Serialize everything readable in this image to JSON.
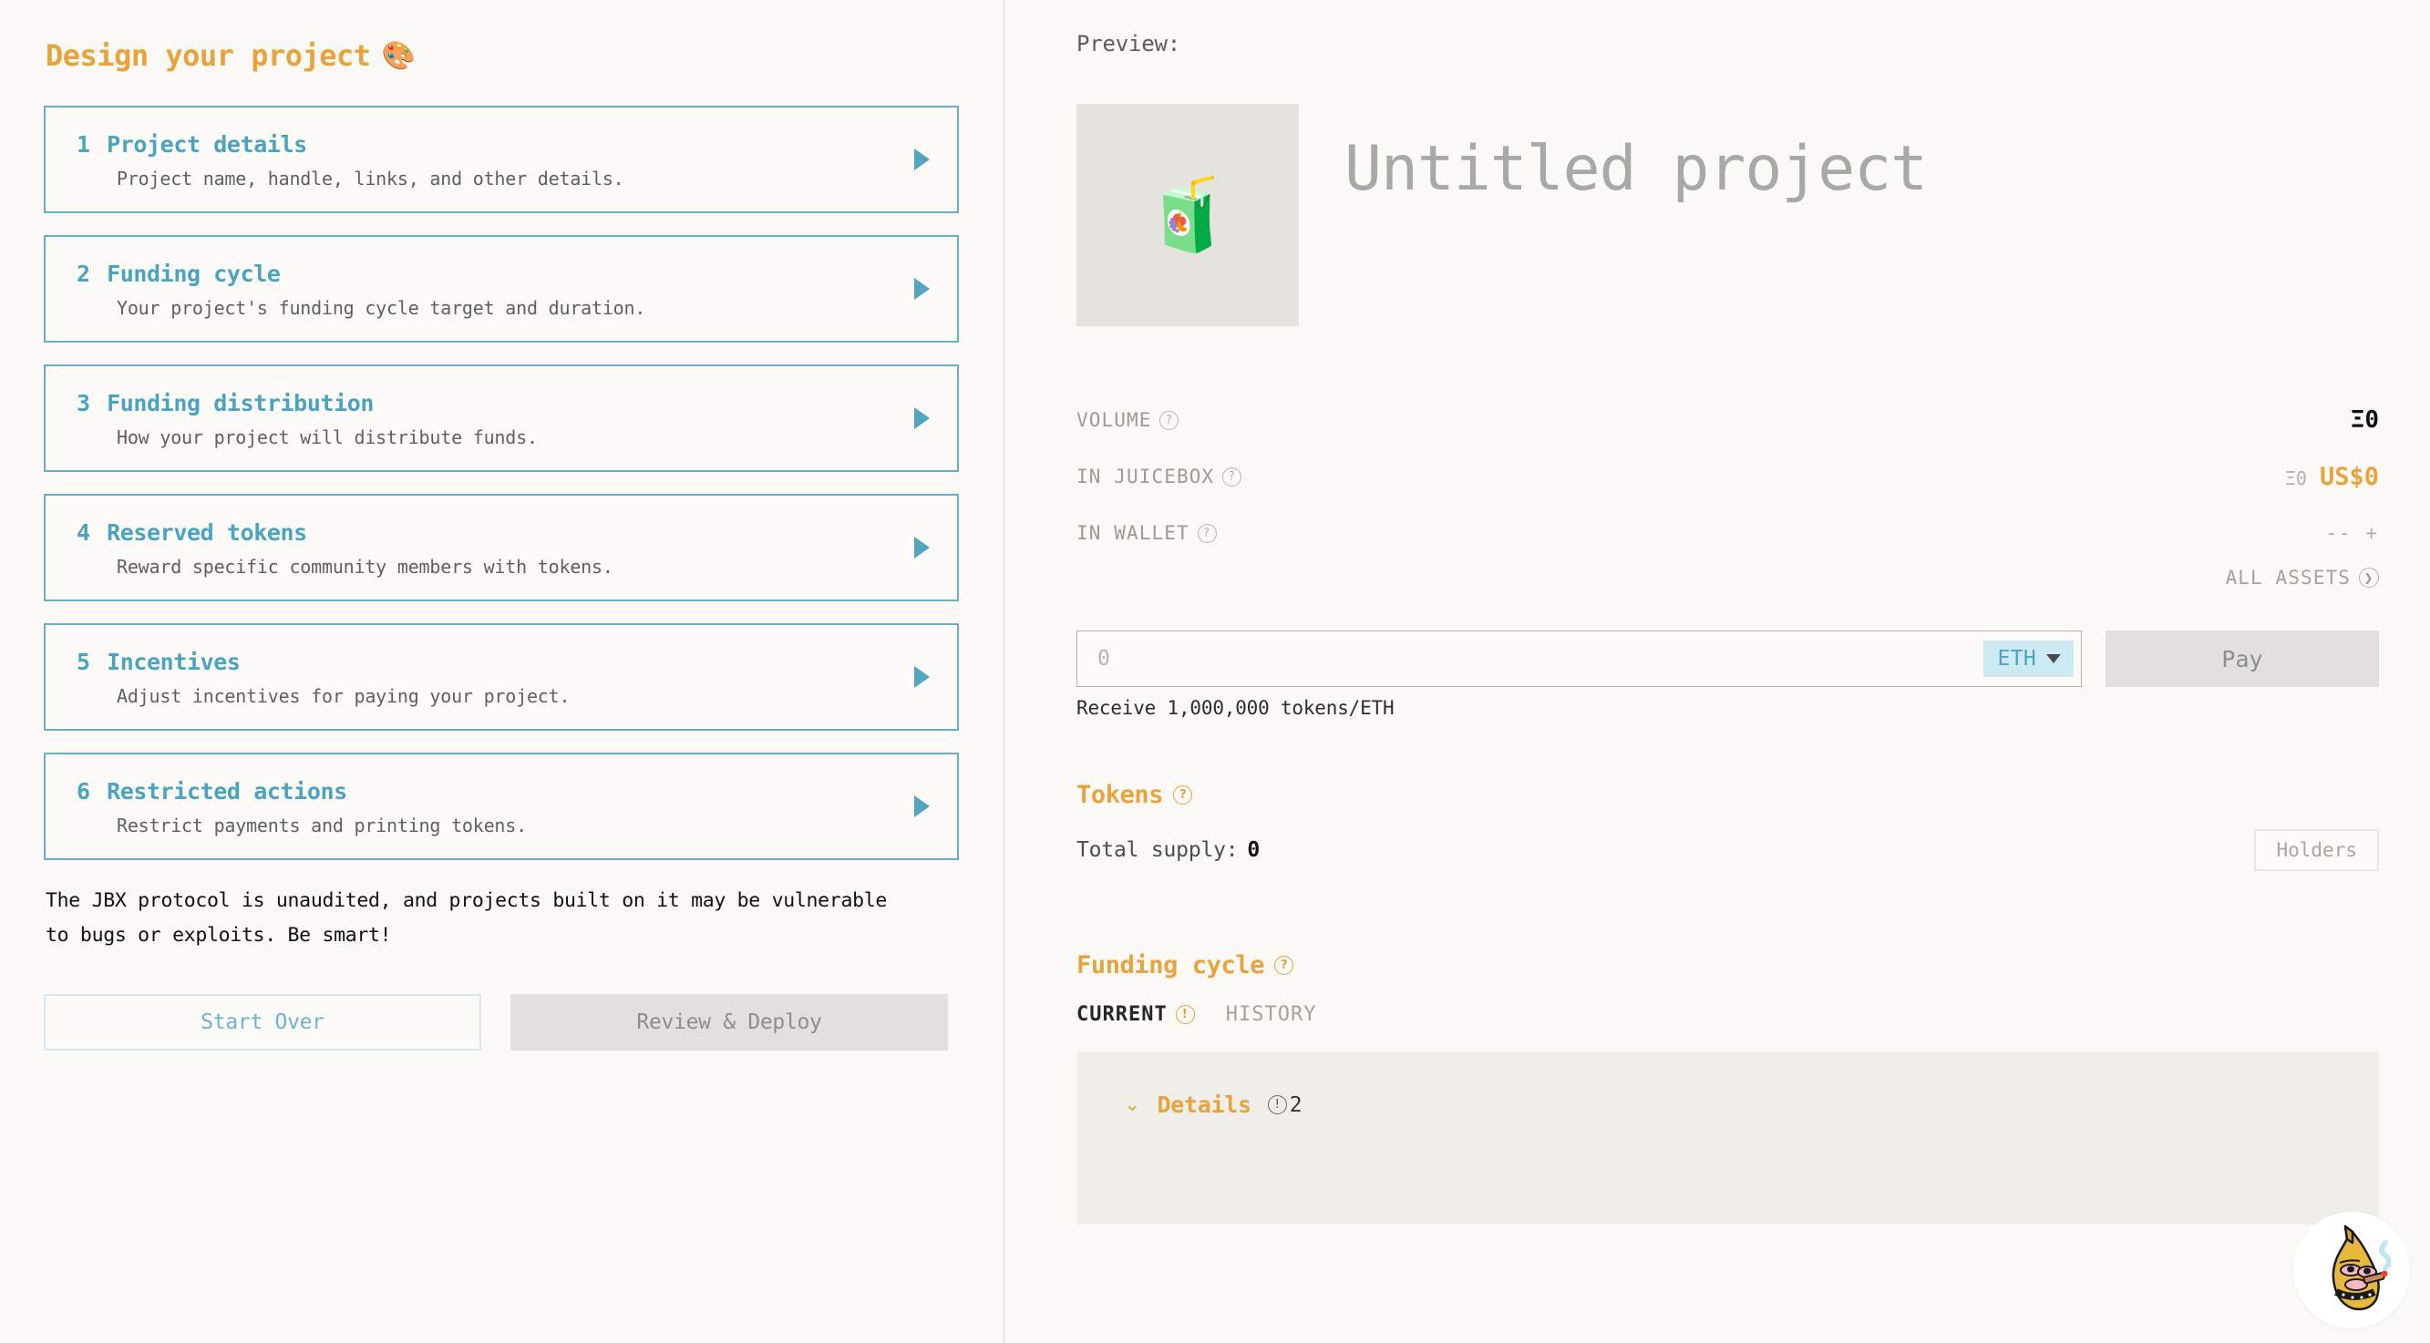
{
  "left": {
    "title": "Design your project",
    "title_emoji": "🎨",
    "steps": [
      {
        "num": "1",
        "name": "Project details",
        "desc": "Project name, handle, links, and other details."
      },
      {
        "num": "2",
        "name": "Funding cycle",
        "desc": "Your project's funding cycle target and duration."
      },
      {
        "num": "3",
        "name": "Funding distribution",
        "desc": "How your project will distribute funds."
      },
      {
        "num": "4",
        "name": "Reserved tokens",
        "desc": "Reward specific community members with tokens."
      },
      {
        "num": "5",
        "name": "Incentives",
        "desc": "Adjust incentives for paying your project."
      },
      {
        "num": "6",
        "name": "Restricted actions",
        "desc": "Restrict payments and printing tokens."
      }
    ],
    "warning": "The JBX protocol is unaudited, and projects built on it may be vulnerable to bugs or exploits. Be smart!",
    "start_over_label": "Start Over",
    "review_deploy_label": "Review & Deploy"
  },
  "preview": {
    "label": "Preview:",
    "project_emoji": "🧃",
    "project_name": "Untitled project",
    "stats": [
      {
        "label": "VOLUME",
        "help": "?",
        "value": "Ξ0",
        "secondary": "",
        "kind": "eth"
      },
      {
        "label": "IN JUICEBOX",
        "help": "?",
        "value": "US$0",
        "secondary": "Ξ0",
        "kind": "usd"
      },
      {
        "label": "IN WALLET",
        "help": "?",
        "value": "-- +",
        "secondary": "",
        "kind": "muted"
      }
    ],
    "all_assets_label": "ALL ASSETS",
    "pay": {
      "input_placeholder": "0",
      "input_value": "",
      "currency": "ETH",
      "pay_label": "Pay",
      "receive_note": "Receive 1,000,000 tokens/ETH"
    },
    "tokens": {
      "heading": "Tokens",
      "help": "?",
      "total_supply_label": "Total supply:",
      "total_supply_value": "0",
      "holders_label": "Holders"
    },
    "funding_cycle": {
      "heading": "Funding cycle",
      "help": "?",
      "tabs": [
        {
          "label": "CURRENT",
          "badge": "!",
          "active": true
        },
        {
          "label": "HISTORY",
          "badge": "",
          "active": false
        }
      ],
      "details_label": "Details",
      "details_badge": "!",
      "details_count": "2",
      "chevron": "⌄"
    }
  },
  "colors": {
    "accent_orange": "#e8a33d",
    "accent_teal": "#4aa3c0",
    "card_border": "#6aadc4",
    "background": "#faf9f6",
    "muted_text": "#9d9a95"
  }
}
